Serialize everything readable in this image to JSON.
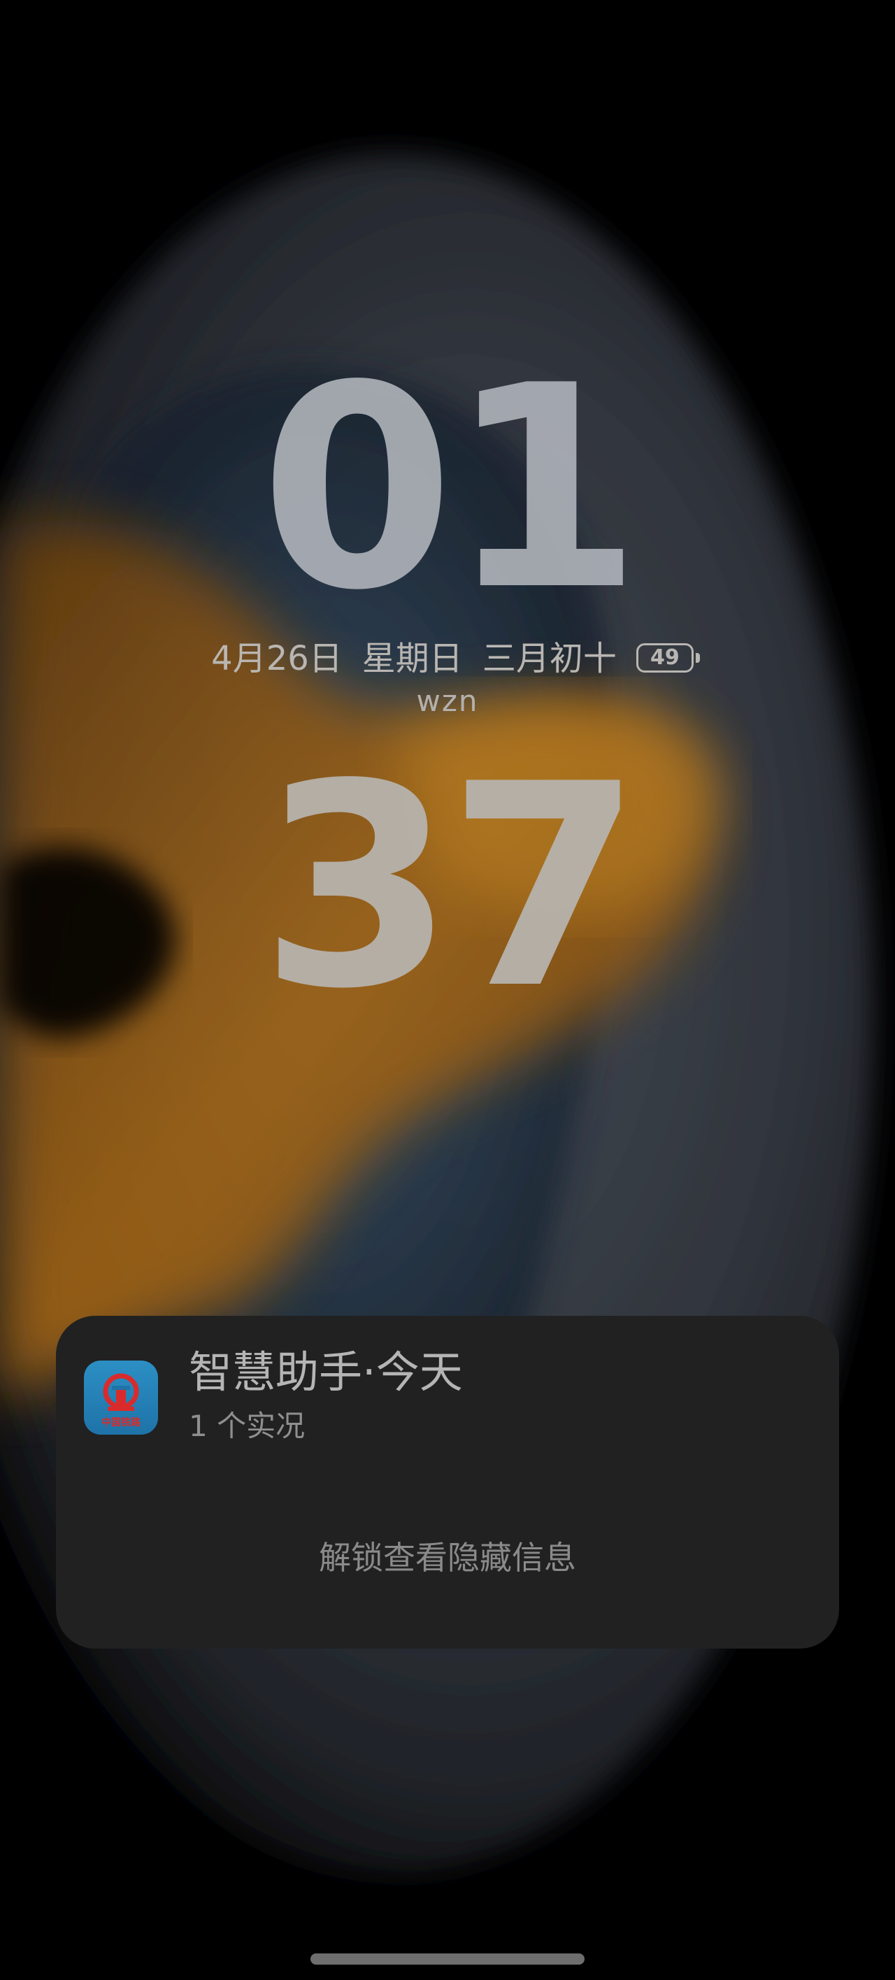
{
  "lockscreen": {
    "hour": "01",
    "minute": "37",
    "date": "4月26日",
    "weekday": "星期日",
    "lunar_date": "三月初十",
    "battery_level": "49",
    "owner_name": "wzn"
  },
  "notification": {
    "app_icon": "china-railway-icon",
    "app_icon_label": "中国铁路",
    "title": "智慧助手·今天",
    "subtitle": "1 个实况",
    "hidden_message": "解锁查看隐藏信息"
  },
  "colors": {
    "background": "#000000",
    "card": "#212121",
    "accent_orange": "#d98a1c",
    "accent_blue": "#3b5e80"
  }
}
